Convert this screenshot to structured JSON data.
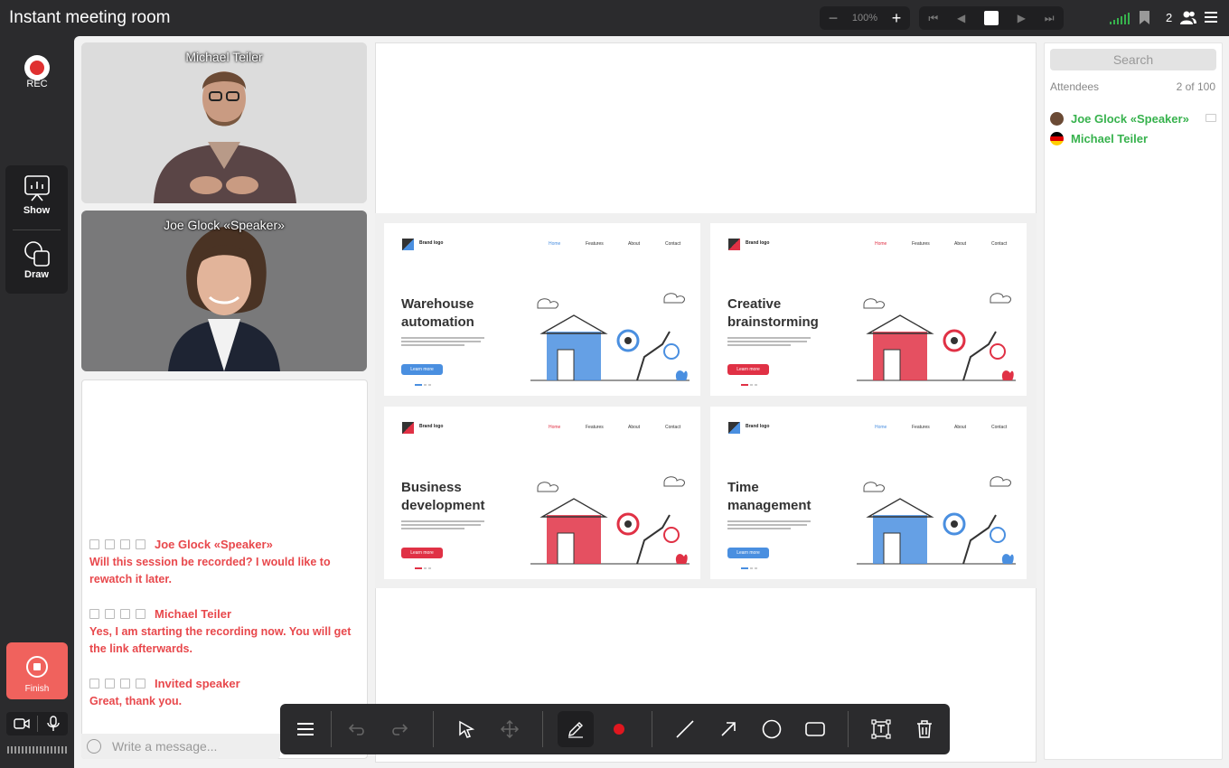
{
  "app": {
    "title": "Instant meeting room"
  },
  "topbar": {
    "zoom_value": "100%",
    "zoom_out": "−",
    "zoom_in": "+",
    "attendee_count": "2"
  },
  "leftrail": {
    "rec_label": "REC",
    "show_label": "Show",
    "draw_label": "Draw",
    "finish_label": "Finish"
  },
  "videos": {
    "tile1_name": "Michael Teiler",
    "tile2_name": "Joe Glock «Speaker»"
  },
  "chat": {
    "messages": [
      {
        "author": "Joe Glock «Speaker»",
        "text": "Will this session be recorded? I would like to rewatch it later."
      },
      {
        "author": "Michael Teiler",
        "text": "Yes, I am starting the recording now. You will get the link afterwards."
      },
      {
        "author": "Invited speaker",
        "text": "Great, thank you."
      }
    ],
    "input_placeholder": "Write a message..."
  },
  "slides": [
    {
      "heading_l1": "Warehouse",
      "heading_l2": "automation",
      "accent": "#4a8fe0",
      "brand": "Brand logo",
      "nav": [
        "Home",
        "Features",
        "About",
        "Contact"
      ],
      "cta": "Learn more"
    },
    {
      "heading_l1": "Creative",
      "heading_l2": "brainstorming",
      "accent": "#e03145",
      "brand": "Brand logo",
      "nav": [
        "Home",
        "Features",
        "About",
        "Contact"
      ],
      "cta": "Learn more"
    },
    {
      "heading_l1": "Business",
      "heading_l2": "development",
      "accent": "#e03145",
      "brand": "Brand logo",
      "nav": [
        "Home",
        "Features",
        "About",
        "Contact"
      ],
      "cta": "Learn more"
    },
    {
      "heading_l1": "Time",
      "heading_l2": "management",
      "accent": "#4a8fe0",
      "brand": "Brand logo",
      "nav": [
        "Home",
        "Features",
        "About",
        "Contact"
      ],
      "cta": "Learn more"
    }
  ],
  "attendees_panel": {
    "search_placeholder": "Search",
    "label": "Attendees",
    "total": "2 of 100",
    "list": [
      {
        "name": "Joe Glock «Speaker»"
      },
      {
        "name": "Michael Teiler"
      }
    ]
  },
  "colors": {
    "accent_red": "#e8484c",
    "attendee_green": "#37b24d",
    "finish": "#f0625d"
  },
  "drawing_toolbar": {
    "tools": [
      "menu-icon",
      "undo-icon",
      "redo-icon",
      "select-icon",
      "move-icon",
      "pencil-icon",
      "color-dot-icon",
      "line-icon",
      "arrow-icon",
      "circle-icon",
      "rectangle-icon",
      "text-icon",
      "trash-icon"
    ]
  }
}
